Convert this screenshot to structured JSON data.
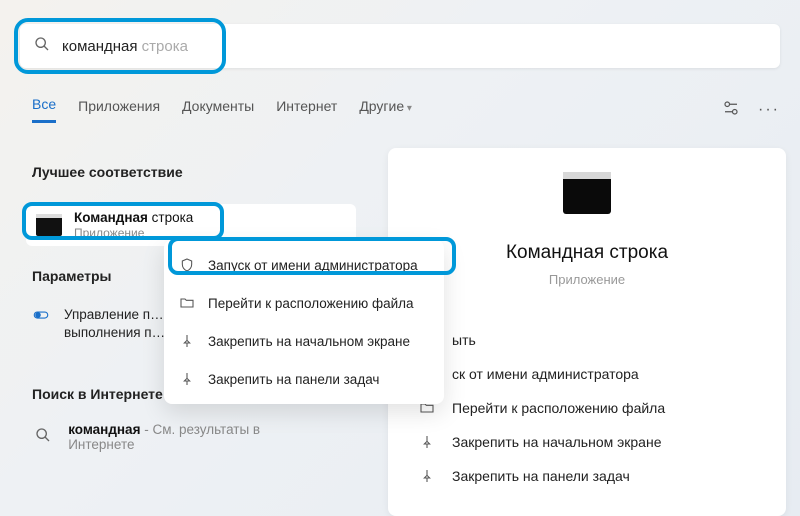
{
  "search": {
    "typed": "командная",
    "ghost": " строка"
  },
  "tabs": {
    "all": "Все",
    "apps": "Приложения",
    "docs": "Документы",
    "web": "Интернет",
    "more": "Другие"
  },
  "sections": {
    "best_match": "Лучшее соответствие",
    "params": "Параметры",
    "web_search": "Поиск в Интернете"
  },
  "app_result": {
    "title_plain": "Командная ",
    "title_rest": "строка",
    "subtitle": "Приложение"
  },
  "context_menu": {
    "run_admin": "Запуск от имени администратора",
    "open_location": "Перейти к расположению файла",
    "pin_start": "Закрепить на начальном экране",
    "pin_taskbar": "Закрепить на панели задач"
  },
  "param_row": {
    "line1": "Управление п…",
    "line2": "выполнения п…"
  },
  "web_row": {
    "query": "командная",
    "suffix": " - См. результаты в Интернете"
  },
  "preview": {
    "title": "Командная строка",
    "subtitle": "Приложение",
    "open_trunc": "ыть",
    "admin_trunc": "ск от имени администратора",
    "open_location": "Перейти к расположению файла",
    "pin_start": "Закрепить на начальном экране",
    "pin_taskbar": "Закрепить на панели задач"
  }
}
